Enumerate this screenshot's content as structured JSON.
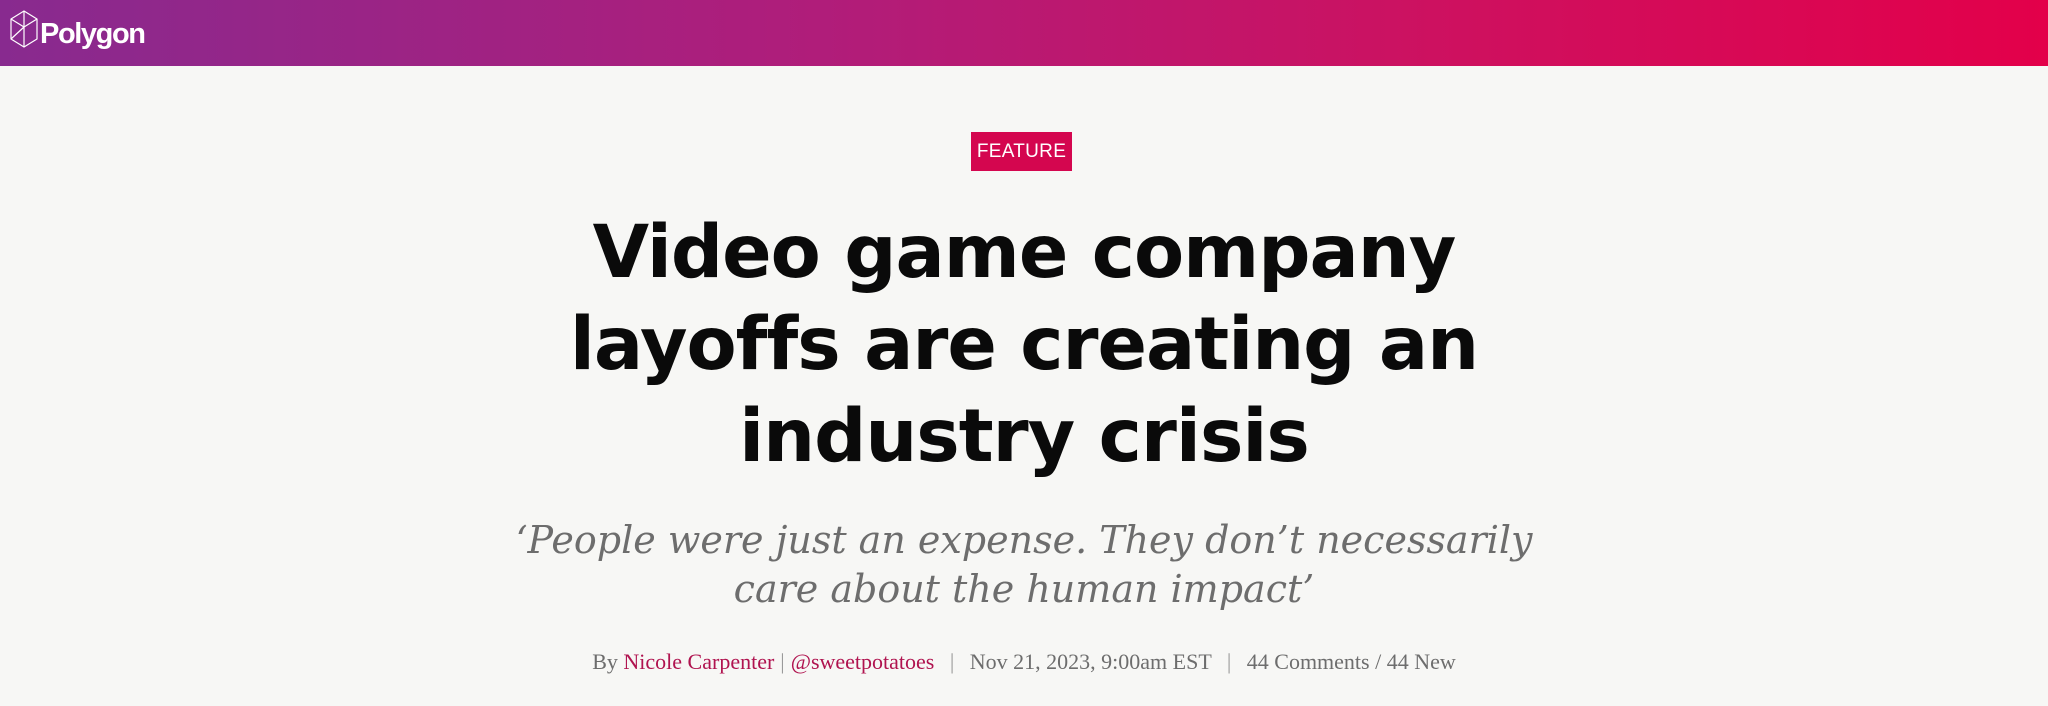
{
  "header": {
    "logo_text": "Polygon",
    "gradient": [
      "#882a8f",
      "#e3004a"
    ]
  },
  "article": {
    "badge": "FEATURE",
    "badge_color": "#d4064f",
    "headline": "Video game company layoffs are creating an industry crisis",
    "dek": "‘People were just an expense. They don’t necessarily care about the human impact’",
    "byline": {
      "prefix": "By",
      "author": "Nicole Carpenter",
      "separator": "|",
      "handle": "@sweetpotatoes",
      "date": "Nov 21, 2023, 9:00am EST",
      "comments": "44 Comments / 44 New",
      "link_color": "#b0134f"
    }
  }
}
